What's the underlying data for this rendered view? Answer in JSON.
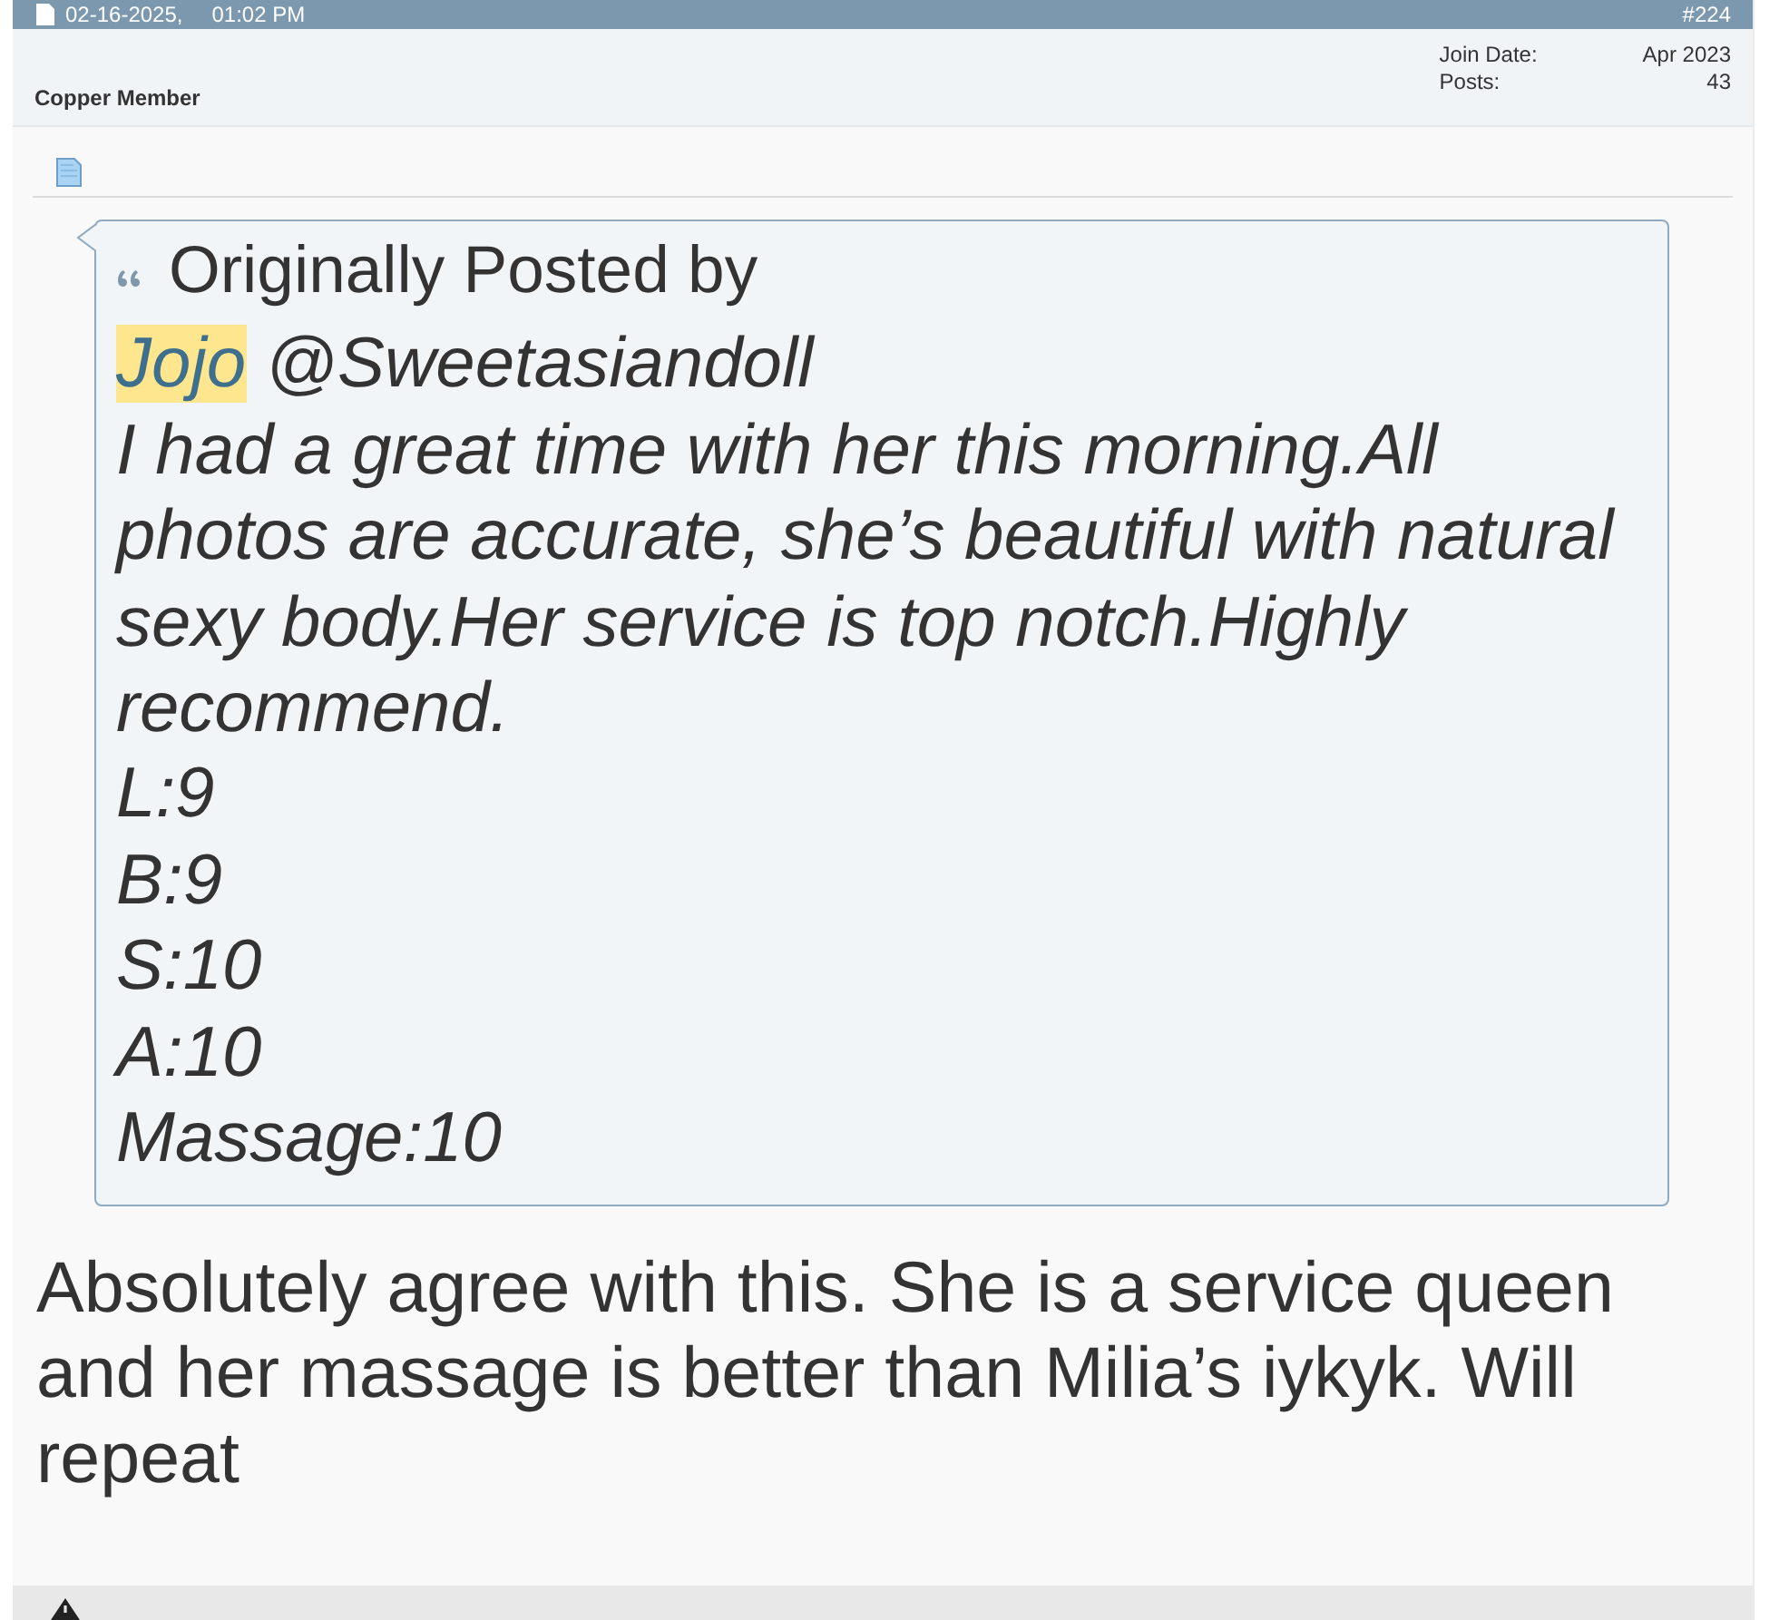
{
  "post_header": {
    "date": "02-16-2025,",
    "time": "01:02 PM",
    "post_number": "#224"
  },
  "user": {
    "title": "Copper Member",
    "stats": [
      {
        "label": "Join Date:",
        "value": "Apr 2023"
      },
      {
        "label": "Posts:",
        "value": "43"
      }
    ]
  },
  "quote": {
    "attribution": "Originally Posted by",
    "mention_line": [
      {
        "text": "Jojo",
        "highlighted": true
      },
      {
        "text": "@Sweetasiandoll",
        "highlighted": false
      }
    ],
    "text": "I had a great time with her this morning.All photos are accurate, she’s beautiful with natural sexy body.Her service is top notch.Highly recommend.",
    "ratings": [
      "L:9",
      "B:9",
      "S:10",
      "A:10",
      "Massage:10"
    ]
  },
  "message": "Absolutely agree with this. She is a service queen and her massage is better than Milia’s iykyk. Will repeat"
}
